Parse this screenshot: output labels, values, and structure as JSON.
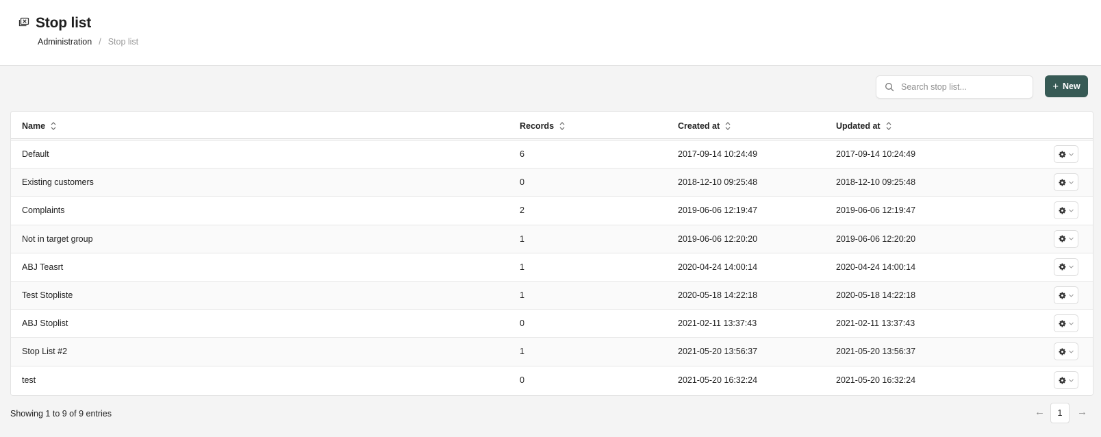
{
  "page": {
    "title": "Stop list",
    "title_icon": "stop-list-icon"
  },
  "breadcrumb": {
    "parent": "Administration",
    "separator": "/",
    "current": "Stop list"
  },
  "toolbar": {
    "search_placeholder": "Search stop list...",
    "search_value": "",
    "new_label": "New",
    "accent_color": "#375a55"
  },
  "table": {
    "columns": {
      "name": "Name",
      "records": "Records",
      "created": "Created at",
      "updated": "Updated at"
    },
    "rows": [
      {
        "name": "Default",
        "records": "6",
        "created": "2017-09-14 10:24:49",
        "updated": "2017-09-14 10:24:49"
      },
      {
        "name": "Existing customers",
        "records": "0",
        "created": "2018-12-10 09:25:48",
        "updated": "2018-12-10 09:25:48"
      },
      {
        "name": "Complaints",
        "records": "2",
        "created": "2019-06-06 12:19:47",
        "updated": "2019-06-06 12:19:47"
      },
      {
        "name": "Not in target group",
        "records": "1",
        "created": "2019-06-06 12:20:20",
        "updated": "2019-06-06 12:20:20"
      },
      {
        "name": "ABJ Teasrt",
        "records": "1",
        "created": "2020-04-24 14:00:14",
        "updated": "2020-04-24 14:00:14"
      },
      {
        "name": "Test Stopliste",
        "records": "1",
        "created": "2020-05-18 14:22:18",
        "updated": "2020-05-18 14:22:18"
      },
      {
        "name": "ABJ Stoplist",
        "records": "0",
        "created": "2021-02-11 13:37:43",
        "updated": "2021-02-11 13:37:43"
      },
      {
        "name": "Stop List #2",
        "records": "1",
        "created": "2021-05-20 13:56:37",
        "updated": "2021-05-20 13:56:37"
      },
      {
        "name": "test",
        "records": "0",
        "created": "2021-05-20 16:32:24",
        "updated": "2021-05-20 16:32:24"
      }
    ]
  },
  "footer": {
    "showing": "Showing 1 to 9 of 9 entries",
    "prev": "←",
    "page": "1",
    "next": "→"
  }
}
